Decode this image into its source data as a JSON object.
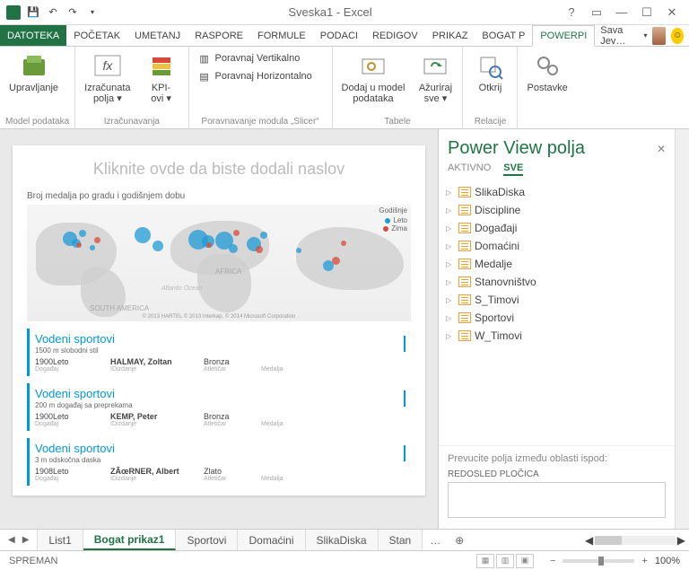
{
  "titlebar": {
    "title": "Sveska1 - Excel"
  },
  "ribbon_tabs": {
    "file": "DATOTEKA",
    "items": [
      "POČETAK",
      "UMETANJ",
      "RASPORE",
      "FORMULE",
      "PODACI",
      "REDIGOV",
      "PRIKAZ",
      "BOGAT P",
      "POWERPI"
    ],
    "active": "POWERPI",
    "account": "Sava Jev…"
  },
  "ribbon": {
    "groups": {
      "model": {
        "label": "Model podataka",
        "manage": "Upravljanje"
      },
      "calc": {
        "label": "Izračunavanja",
        "fields": "Izračunata\npolja ▾",
        "kpi": "KPI-\novi ▾"
      },
      "slicer": {
        "label": "Poravnavanje modula „Slicer“",
        "v": "Poravnaj Vertikalno",
        "h": "Poravnaj Horizontalno"
      },
      "tables": {
        "label": "Tabele",
        "add": "Dodaj u model\npodataka",
        "refresh": "Ažuriraj\nsve ▾"
      },
      "rel": {
        "label": "Relacije",
        "detect": "Otkrij"
      },
      "settings": {
        "btn": "Postavke"
      }
    }
  },
  "report": {
    "title_placeholder": "Kliknite ovde da biste dodali naslov",
    "map_title": "Broj medalja po gradu i godišnjem dobu",
    "legend_title": "Godišnje",
    "legend": [
      {
        "label": "Leto",
        "color": "#1f9bd6"
      },
      {
        "label": "Zima",
        "color": "#d84b3a"
      }
    ],
    "map_credits": "© 2013 HARTEL © 2013 Interkap, © 2014 Microsoft Corporation",
    "tiles": [
      {
        "heading": "Vodeni sportovi",
        "sub": "1500 m slobodni stil",
        "year": "1900Leto",
        "name": "HALMAY, Zoltan",
        "medal": "Bronza",
        "cols": [
          "Događaj",
          "IDizdanje",
          "Atletičar",
          "Medalja"
        ]
      },
      {
        "heading": "Vodeni sportovi",
        "sub": "200 m događaj sa preprekama",
        "year": "1900Leto",
        "name": "KEMP, Peter",
        "medal": "Bronza",
        "cols": [
          "Događaj",
          "IDizdanje",
          "Atletičar",
          "Medalja"
        ]
      },
      {
        "heading": "Vodeni sportovi",
        "sub": "3 m odskočna daska",
        "year": "1908Leto",
        "name": "ZÃœRNER, Albert",
        "medal": "Zlato",
        "cols": [
          "Događaj",
          "IDizdanje",
          "Atletičar",
          "Medalja"
        ]
      }
    ]
  },
  "pane": {
    "title": "Power View polja",
    "tabs": {
      "active": "AKTIVNO",
      "all": "SVE"
    },
    "tables": [
      "SlikaDiska",
      "Discipline",
      "Događaji",
      "Domaćini",
      "Medalje",
      "Stanovništvo",
      "S_Timovi",
      "Sportovi",
      "W_Timovi"
    ],
    "drop_hint": "Prevucite polja između oblasti ispod:",
    "drop_label": "REDOSLED PLOČICA"
  },
  "sheets": {
    "items": [
      "List1",
      "Bogat prikaz1",
      "Sportovi",
      "Domaćini",
      "SlikaDiska",
      "Stan"
    ],
    "active": "Bogat prikaz1",
    "more": "…"
  },
  "status": {
    "ready": "SPREMAN",
    "zoom": "100%"
  },
  "chart_data": {
    "type": "scatter",
    "title": "Broj medalja po gradu i godišnjem dobu",
    "series": [
      {
        "name": "Leto",
        "color": "#1f9bd6",
        "points_xy_size": [
          [
            40,
            30,
            16
          ],
          [
            50,
            38,
            10
          ],
          [
            58,
            28,
            8
          ],
          [
            70,
            45,
            6
          ],
          [
            120,
            25,
            18
          ],
          [
            140,
            40,
            12
          ],
          [
            180,
            28,
            22
          ],
          [
            195,
            34,
            14
          ],
          [
            210,
            30,
            20
          ],
          [
            225,
            44,
            10
          ],
          [
            245,
            36,
            16
          ],
          [
            260,
            30,
            8
          ],
          [
            300,
            48,
            6
          ],
          [
            330,
            62,
            12
          ]
        ]
      },
      {
        "name": "Zima",
        "color": "#d84b3a",
        "points_xy_size": [
          [
            55,
            42,
            6
          ],
          [
            75,
            36,
            7
          ],
          [
            200,
            42,
            6
          ],
          [
            230,
            28,
            7
          ],
          [
            255,
            46,
            8
          ],
          [
            340,
            58,
            9
          ],
          [
            350,
            40,
            6
          ]
        ]
      }
    ],
    "note": "x/y are pixel placements over an untitled world-map background; true geo coords not labeled in source."
  }
}
